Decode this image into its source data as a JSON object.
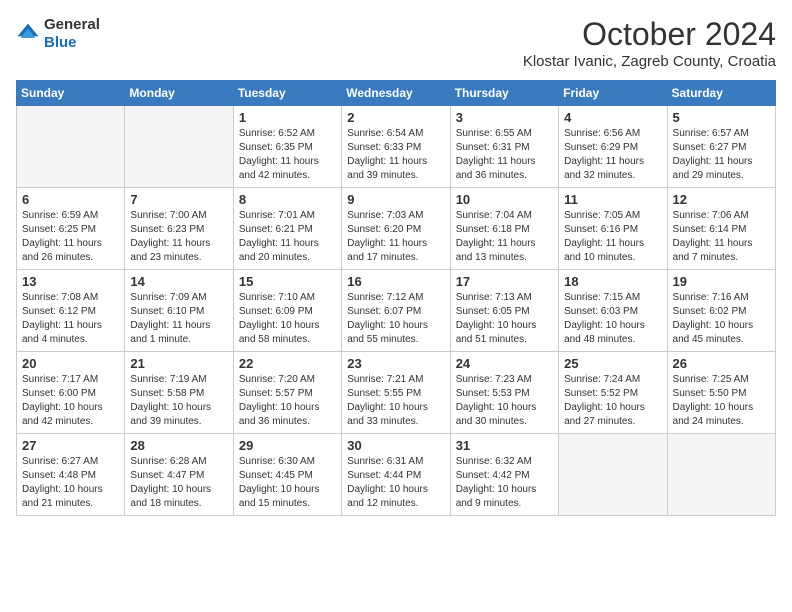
{
  "header": {
    "logo_general": "General",
    "logo_blue": "Blue",
    "month_title": "October 2024",
    "location": "Klostar Ivanic, Zagreb County, Croatia"
  },
  "days_of_week": [
    "Sunday",
    "Monday",
    "Tuesday",
    "Wednesday",
    "Thursday",
    "Friday",
    "Saturday"
  ],
  "weeks": [
    [
      {
        "day": "",
        "info": ""
      },
      {
        "day": "",
        "info": ""
      },
      {
        "day": "1",
        "info": "Sunrise: 6:52 AM\nSunset: 6:35 PM\nDaylight: 11 hours and 42 minutes."
      },
      {
        "day": "2",
        "info": "Sunrise: 6:54 AM\nSunset: 6:33 PM\nDaylight: 11 hours and 39 minutes."
      },
      {
        "day": "3",
        "info": "Sunrise: 6:55 AM\nSunset: 6:31 PM\nDaylight: 11 hours and 36 minutes."
      },
      {
        "day": "4",
        "info": "Sunrise: 6:56 AM\nSunset: 6:29 PM\nDaylight: 11 hours and 32 minutes."
      },
      {
        "day": "5",
        "info": "Sunrise: 6:57 AM\nSunset: 6:27 PM\nDaylight: 11 hours and 29 minutes."
      }
    ],
    [
      {
        "day": "6",
        "info": "Sunrise: 6:59 AM\nSunset: 6:25 PM\nDaylight: 11 hours and 26 minutes."
      },
      {
        "day": "7",
        "info": "Sunrise: 7:00 AM\nSunset: 6:23 PM\nDaylight: 11 hours and 23 minutes."
      },
      {
        "day": "8",
        "info": "Sunrise: 7:01 AM\nSunset: 6:21 PM\nDaylight: 11 hours and 20 minutes."
      },
      {
        "day": "9",
        "info": "Sunrise: 7:03 AM\nSunset: 6:20 PM\nDaylight: 11 hours and 17 minutes."
      },
      {
        "day": "10",
        "info": "Sunrise: 7:04 AM\nSunset: 6:18 PM\nDaylight: 11 hours and 13 minutes."
      },
      {
        "day": "11",
        "info": "Sunrise: 7:05 AM\nSunset: 6:16 PM\nDaylight: 11 hours and 10 minutes."
      },
      {
        "day": "12",
        "info": "Sunrise: 7:06 AM\nSunset: 6:14 PM\nDaylight: 11 hours and 7 minutes."
      }
    ],
    [
      {
        "day": "13",
        "info": "Sunrise: 7:08 AM\nSunset: 6:12 PM\nDaylight: 11 hours and 4 minutes."
      },
      {
        "day": "14",
        "info": "Sunrise: 7:09 AM\nSunset: 6:10 PM\nDaylight: 11 hours and 1 minute."
      },
      {
        "day": "15",
        "info": "Sunrise: 7:10 AM\nSunset: 6:09 PM\nDaylight: 10 hours and 58 minutes."
      },
      {
        "day": "16",
        "info": "Sunrise: 7:12 AM\nSunset: 6:07 PM\nDaylight: 10 hours and 55 minutes."
      },
      {
        "day": "17",
        "info": "Sunrise: 7:13 AM\nSunset: 6:05 PM\nDaylight: 10 hours and 51 minutes."
      },
      {
        "day": "18",
        "info": "Sunrise: 7:15 AM\nSunset: 6:03 PM\nDaylight: 10 hours and 48 minutes."
      },
      {
        "day": "19",
        "info": "Sunrise: 7:16 AM\nSunset: 6:02 PM\nDaylight: 10 hours and 45 minutes."
      }
    ],
    [
      {
        "day": "20",
        "info": "Sunrise: 7:17 AM\nSunset: 6:00 PM\nDaylight: 10 hours and 42 minutes."
      },
      {
        "day": "21",
        "info": "Sunrise: 7:19 AM\nSunset: 5:58 PM\nDaylight: 10 hours and 39 minutes."
      },
      {
        "day": "22",
        "info": "Sunrise: 7:20 AM\nSunset: 5:57 PM\nDaylight: 10 hours and 36 minutes."
      },
      {
        "day": "23",
        "info": "Sunrise: 7:21 AM\nSunset: 5:55 PM\nDaylight: 10 hours and 33 minutes."
      },
      {
        "day": "24",
        "info": "Sunrise: 7:23 AM\nSunset: 5:53 PM\nDaylight: 10 hours and 30 minutes."
      },
      {
        "day": "25",
        "info": "Sunrise: 7:24 AM\nSunset: 5:52 PM\nDaylight: 10 hours and 27 minutes."
      },
      {
        "day": "26",
        "info": "Sunrise: 7:25 AM\nSunset: 5:50 PM\nDaylight: 10 hours and 24 minutes."
      }
    ],
    [
      {
        "day": "27",
        "info": "Sunrise: 6:27 AM\nSunset: 4:48 PM\nDaylight: 10 hours and 21 minutes."
      },
      {
        "day": "28",
        "info": "Sunrise: 6:28 AM\nSunset: 4:47 PM\nDaylight: 10 hours and 18 minutes."
      },
      {
        "day": "29",
        "info": "Sunrise: 6:30 AM\nSunset: 4:45 PM\nDaylight: 10 hours and 15 minutes."
      },
      {
        "day": "30",
        "info": "Sunrise: 6:31 AM\nSunset: 4:44 PM\nDaylight: 10 hours and 12 minutes."
      },
      {
        "day": "31",
        "info": "Sunrise: 6:32 AM\nSunset: 4:42 PM\nDaylight: 10 hours and 9 minutes."
      },
      {
        "day": "",
        "info": ""
      },
      {
        "day": "",
        "info": ""
      }
    ]
  ]
}
